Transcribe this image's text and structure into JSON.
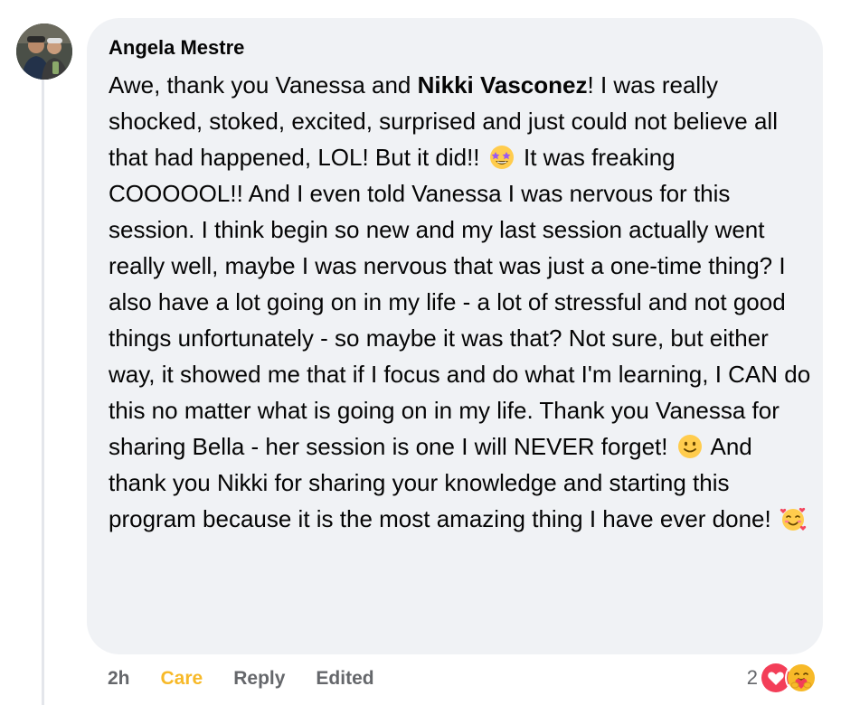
{
  "comment": {
    "author": "Angela Mestre",
    "segments": {
      "s1": "Awe, thank you Vanessa and ",
      "mention": "Nikki Vasconez",
      "s2": "! I was really shocked, stoked, excited, surprised and just could not believe all that had happened, LOL! But it did!! ",
      "emoji1": "star-struck-emoji",
      "s3": " It was freaking COOOOOL!! And I even told Vanessa I was nervous for this session. I think begin so new and my last session actually went really well, maybe I was nervous that was just a one-time thing? I also have a lot going on in my life - a lot of stressful and not good things unfortunately - so maybe it was that? Not sure, but either way, it showed me that if I focus and do what I'm learning, I CAN do this no matter what is going on in my life. Thank you Vanessa for sharing Bella - her session is one I will NEVER forget! ",
      "emoji2": "slightly-smiling-face-emoji",
      "s4": " And thank you Nikki for sharing your knowledge and starting this program because it is the most amazing thing I have ever done! ",
      "emoji3": "smiling-face-with-hearts-emoji"
    }
  },
  "actions": {
    "time": "2h",
    "care": "Care",
    "reply": "Reply",
    "edited": "Edited"
  },
  "reactions": {
    "count": "2",
    "icons": [
      "love-reaction-icon",
      "care-reaction-icon"
    ]
  },
  "colors": {
    "bubble": "#f0f2f5",
    "text": "#050505",
    "secondary": "#65676b",
    "care": "#f7b928",
    "love": "#f33e58"
  }
}
